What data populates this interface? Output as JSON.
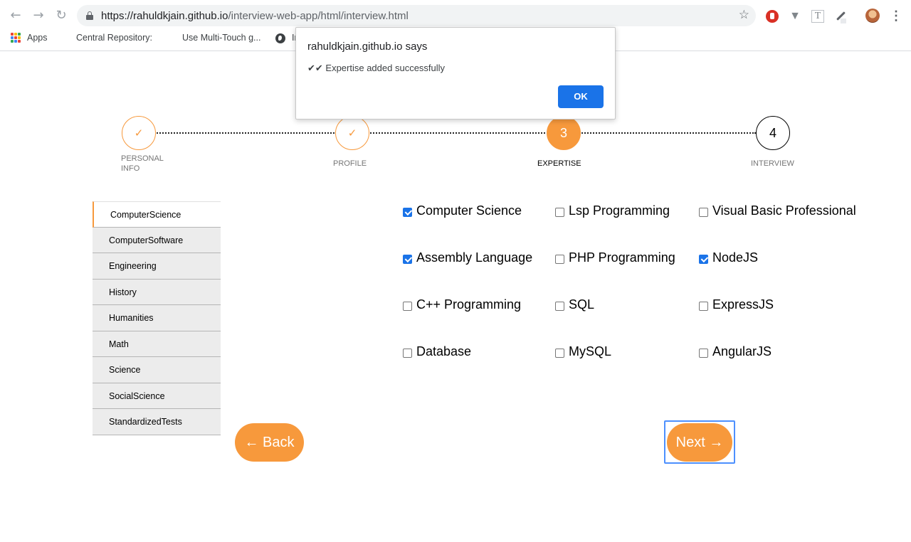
{
  "browser": {
    "url_host": "https://rahuldkjain.github.io",
    "url_path": "/interview-web-app/html/interview.html",
    "bookmarks": [
      "Apps",
      "Central Repository:",
      "Use Multi-Touch g...",
      "In"
    ]
  },
  "dialog": {
    "title": "rahuldkjain.github.io says",
    "message": "✔✔ Expertise added successfully",
    "ok_label": "OK"
  },
  "stepper": {
    "steps": [
      {
        "label": "PERSONAL\nINFO",
        "marker": "✓",
        "state": "done"
      },
      {
        "label": "PROFILE",
        "marker": "✓",
        "state": "done"
      },
      {
        "label": "EXPERTISE",
        "marker": "3",
        "state": "active"
      },
      {
        "label": "INTERVIEW",
        "marker": "4",
        "state": "todo"
      }
    ]
  },
  "sidebar": {
    "items": [
      "ComputerScience",
      "ComputerSoftware",
      "Engineering",
      "History",
      "Humanities",
      "Math",
      "Science",
      "SocialScience",
      "StandardizedTests"
    ],
    "active": "ComputerScience"
  },
  "skills": [
    {
      "label": "Computer Science",
      "checked": true
    },
    {
      "label": "Lsp Programming",
      "checked": false
    },
    {
      "label": "Visual Basic Professional",
      "checked": false
    },
    {
      "label": "Assembly Language",
      "checked": true
    },
    {
      "label": "PHP Programming",
      "checked": false
    },
    {
      "label": "NodeJS",
      "checked": true
    },
    {
      "label": "C++ Programming",
      "checked": false
    },
    {
      "label": "SQL",
      "checked": false
    },
    {
      "label": "ExpressJS",
      "checked": false
    },
    {
      "label": "Database",
      "checked": false
    },
    {
      "label": "MySQL",
      "checked": false
    },
    {
      "label": "AngularJS",
      "checked": false
    }
  ],
  "buttons": {
    "back_label": "← Back",
    "next_label": "Next →"
  },
  "colors": {
    "accent": "#f7993c",
    "checkbox": "#1a73e8",
    "dialog_button": "#1a73e8"
  }
}
